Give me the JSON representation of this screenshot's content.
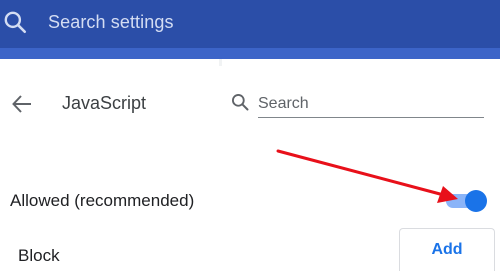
{
  "header": {
    "search_placeholder": "Search settings",
    "background_color": "#2b4ea8"
  },
  "page": {
    "title": "JavaScript",
    "search_placeholder": "Search"
  },
  "settings": {
    "allowed_label": "Allowed (recommended)",
    "allowed_toggle_on": true,
    "block_label": "Block",
    "add_button_label": "Add"
  },
  "annotation": {
    "arrow_color": "#e8101a"
  },
  "colors": {
    "accent": "#1a73e8",
    "toggle_track": "#8ab4f8"
  },
  "icons": [
    "search-icon",
    "back-arrow-icon",
    "search-icon"
  ]
}
